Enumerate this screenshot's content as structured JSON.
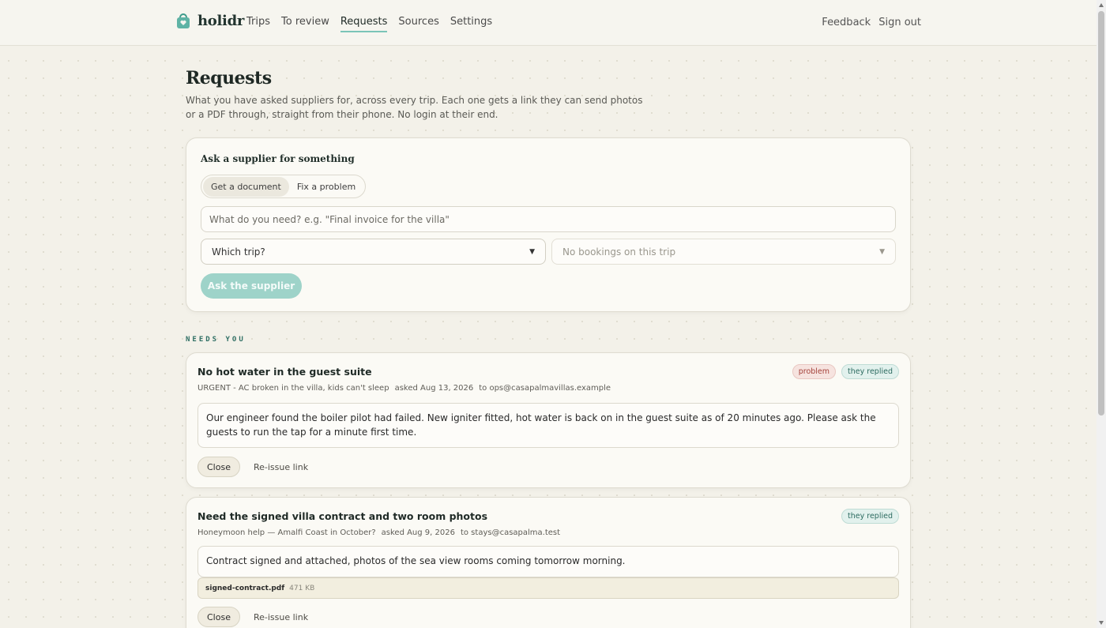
{
  "brand": {
    "name": "holidr",
    "logo_icon": "bag-heart-icon",
    "accent": "#7bc4b8"
  },
  "nav": {
    "items": [
      "Trips",
      "To review",
      "Requests",
      "Sources",
      "Settings"
    ],
    "active": "Requests",
    "right": [
      "Feedback",
      "Sign out"
    ]
  },
  "page": {
    "title": "Requests",
    "subtitle": "What you have asked suppliers for, across every trip. Each one gets a link they can send photos or a PDF through, straight from their phone. No login at their end."
  },
  "ask": {
    "heading": "Ask a supplier for something",
    "modes": [
      "Get a document",
      "Fix a problem"
    ],
    "active_mode": "Get a document",
    "need_placeholder": "What do you need? e.g. \"Final invoice for the villa\"",
    "trip_select": "Which trip?",
    "booking_select": "No bookings on this trip",
    "submit": "Ask the supplier"
  },
  "section_label": "NEEDS YOU",
  "requests": [
    {
      "title": "No hot water in the guest suite",
      "trip": "URGENT - AC broken in the villa, kids can't sleep",
      "asked": "asked Aug 13, 2026",
      "to": "to ops@casapalmavillas.example",
      "badges": [
        "problem",
        "they replied"
      ],
      "reply": "Our engineer found the boiler pilot had failed. New igniter fitted, hot water is back on in the guest suite as of 20 minutes ago. Please ask the guests to run the tap for a minute first time.",
      "close": "Close",
      "reissue": "Re-issue link"
    },
    {
      "title": "Need the signed villa contract and two room photos",
      "trip": "Honeymoon help — Amalfi Coast in October?",
      "asked": "asked Aug 9, 2026",
      "to": "to stays@casapalma.test",
      "badges": [
        "they replied"
      ],
      "reply": "Contract signed and attached, photos of the sea view rooms coming tomorrow morning.",
      "attachment": {
        "name": "signed-contract.pdf",
        "size": "471 KB"
      },
      "close": "Close",
      "reissue": "Re-issue link"
    }
  ]
}
